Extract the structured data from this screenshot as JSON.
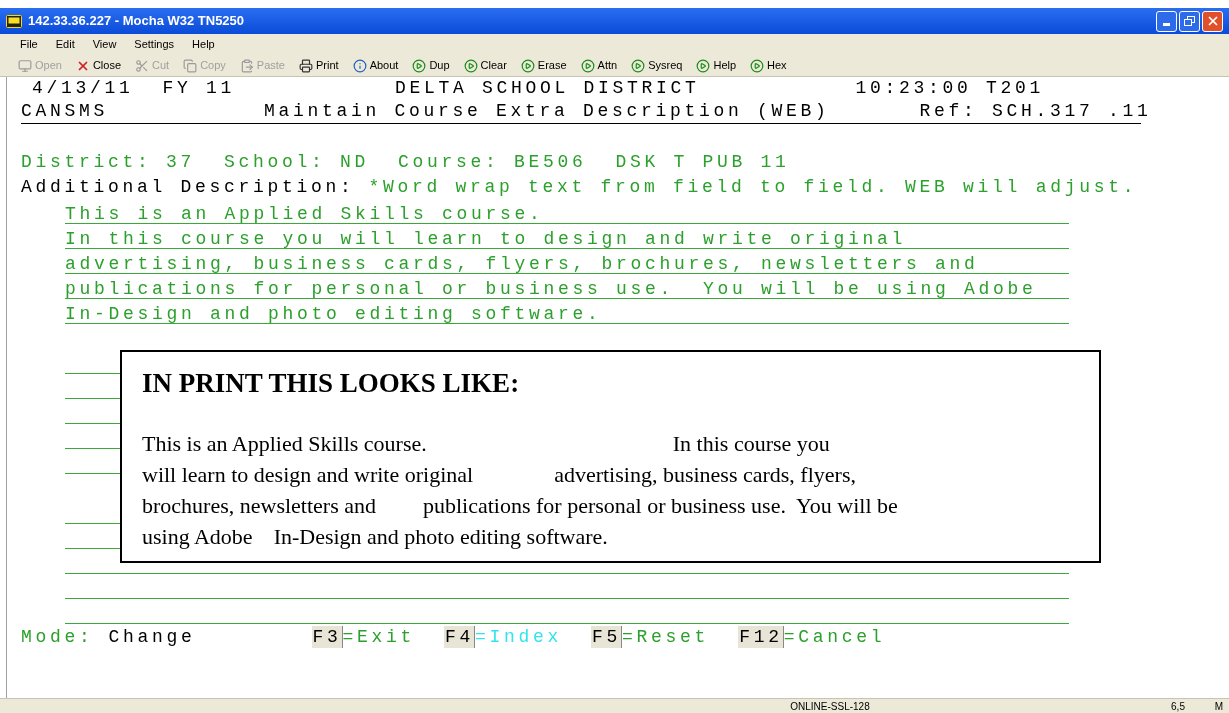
{
  "window": {
    "title": "142.33.36.227 - Mocha W32 TN5250"
  },
  "menu": [
    {
      "label": "File"
    },
    {
      "label": "Edit"
    },
    {
      "label": "View"
    },
    {
      "label": "Settings"
    },
    {
      "label": "Help"
    }
  ],
  "toolbar": [
    {
      "kind": "open",
      "label": "Open",
      "disabled": true
    },
    {
      "kind": "close",
      "label": "Close",
      "disabled": false
    },
    {
      "kind": "cut",
      "label": "Cut",
      "disabled": true
    },
    {
      "kind": "copy",
      "label": "Copy",
      "disabled": true
    },
    {
      "kind": "paste",
      "label": "Paste",
      "disabled": true
    },
    {
      "kind": "print",
      "label": "Print",
      "disabled": false
    },
    {
      "kind": "about",
      "label": "About",
      "disabled": false
    },
    {
      "kind": "key",
      "label": "Dup",
      "disabled": false
    },
    {
      "kind": "key",
      "label": "Clear",
      "disabled": false
    },
    {
      "kind": "key",
      "label": "Erase",
      "disabled": false
    },
    {
      "kind": "key",
      "label": "Attn",
      "disabled": false
    },
    {
      "kind": "key",
      "label": "Sysreq",
      "disabled": false
    },
    {
      "kind": "key",
      "label": "Help",
      "disabled": false
    },
    {
      "kind": "key",
      "label": "Hex",
      "disabled": false
    }
  ],
  "header": {
    "date": "4/13/11  FY 11",
    "organization": "DELTA SCHOOL DISTRICT",
    "time": "10:23:00 T201",
    "program": "CANSMS",
    "screen_title": "Maintain Course Extra Description (WEB)",
    "reference": "Ref: SCH.317 .11"
  },
  "keys_line": "District: 37  School: ND  Course: BE506  DSK T PUB 11",
  "description": {
    "label": "Additional Description:",
    "hint": "*Word wrap text from field to field. WEB will adjust."
  },
  "fields": [
    {
      "kind": "input",
      "value": "This is an Applied Skills course."
    },
    {
      "kind": "input",
      "value": "In this course you will learn to design and write original"
    },
    {
      "kind": "input",
      "value": "advertising, business cards, flyers, brochures, newsletters and"
    },
    {
      "kind": "input",
      "value": "publications for personal or business use.  You will be using Adobe"
    },
    {
      "kind": "input",
      "value": "In-Design and photo editing software."
    },
    {
      "kind": "blank"
    },
    {
      "kind": "input"
    },
    {
      "kind": "input"
    },
    {
      "kind": "input"
    },
    {
      "kind": "input"
    },
    {
      "kind": "input"
    },
    {
      "kind": "blank"
    },
    {
      "kind": "input"
    },
    {
      "kind": "input"
    },
    {
      "kind": "input"
    },
    {
      "kind": "input"
    },
    {
      "kind": "input"
    }
  ],
  "mode": {
    "label": "Mode:",
    "value": "Change"
  },
  "function_keys": [
    {
      "key": "F3",
      "action": "=Exit",
      "color": "#2ca02c"
    },
    {
      "key": "F4",
      "action": "=Index",
      "color": "#33e3ee"
    },
    {
      "key": "F5",
      "action": "=Reset",
      "color": "#2ca02c"
    },
    {
      "key": "F12",
      "action": "=Cancel",
      "color": "#2ca02c"
    }
  ],
  "print_preview": {
    "title": "IN PRINT THIS LOOKS LIKE:",
    "lines": [
      [
        "This is an Applied Skills course.",
        "In this course you"
      ],
      [
        "will learn to design and write original",
        "advertising, business cards, flyers,"
      ],
      [
        "brochures, newsletters and",
        "publications for personal or business use.  You will be"
      ],
      [
        "using Adobe",
        "In-Design and photo editing software."
      ]
    ]
  },
  "status_bar": [
    "ONLINE-SSL-128",
    "6,5",
    "M"
  ]
}
